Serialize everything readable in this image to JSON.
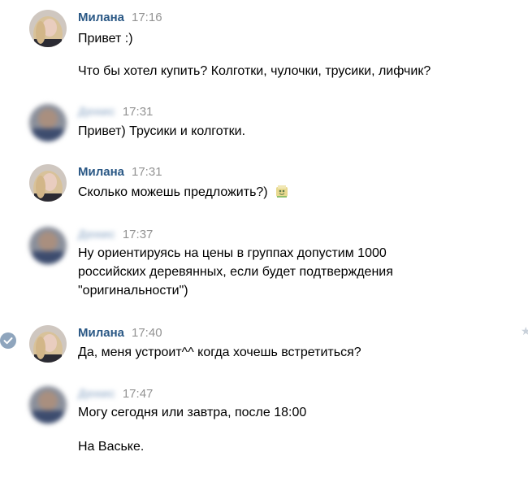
{
  "colors": {
    "author_name": "#2a5885",
    "timestamp": "#939393",
    "message_text": "#000000",
    "read_check": "#8fa5bd"
  },
  "messages": [
    {
      "author": "Милана",
      "time": "17:16",
      "lines": [
        "Привет :)",
        "Что бы хотел купить? Колготки, чулочки, трусики, лифчик?"
      ]
    },
    {
      "author": "Денис",
      "time": "17:31",
      "lines": [
        "Привет) Трусики и колготки."
      ]
    },
    {
      "author": "Милана",
      "time": "17:31",
      "lines": [
        "Сколько можешь предложить?)"
      ],
      "emoji": "money-face-emoji"
    },
    {
      "author": "Денис",
      "time": "17:37",
      "lines": [
        "Ну ориентируясь на цены в группах допустим 1000",
        "российских деревянных, если будет подтверждения",
        "\"оригинальности\")"
      ]
    },
    {
      "author": "Милана",
      "time": "17:40",
      "lines": [
        "Да, меня устроит^^ когда хочешь встретиться?"
      ],
      "icons": [
        "check-circle-icon",
        "star-icon"
      ]
    },
    {
      "author": "Денис",
      "time": "17:47",
      "lines": [
        "Могу сегодня или завтра, после 18:00",
        "На Ваське."
      ]
    }
  ]
}
